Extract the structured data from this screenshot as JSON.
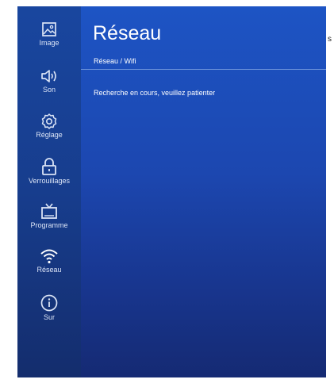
{
  "edge_glyph": "s",
  "sidebar": {
    "items": [
      {
        "label": "Image",
        "icon": "image-icon"
      },
      {
        "label": "Son",
        "icon": "speaker-icon"
      },
      {
        "label": "Réglage",
        "icon": "settings-gear-icon"
      },
      {
        "label": "Verrouillages",
        "icon": "lock-icon"
      },
      {
        "label": "Programme",
        "icon": "tv-icon"
      },
      {
        "label": "Réseau",
        "icon": "wifi-icon"
      },
      {
        "label": "Sur",
        "icon": "info-icon"
      }
    ]
  },
  "header": {
    "title": "Réseau",
    "breadcrumb": "Réseau / Wifi"
  },
  "main": {
    "status": "Recherche en cours, veuillez patienter"
  },
  "colors": {
    "background": "#1c47b0",
    "sidebar": "#173d8d",
    "text": "#ffffff"
  }
}
